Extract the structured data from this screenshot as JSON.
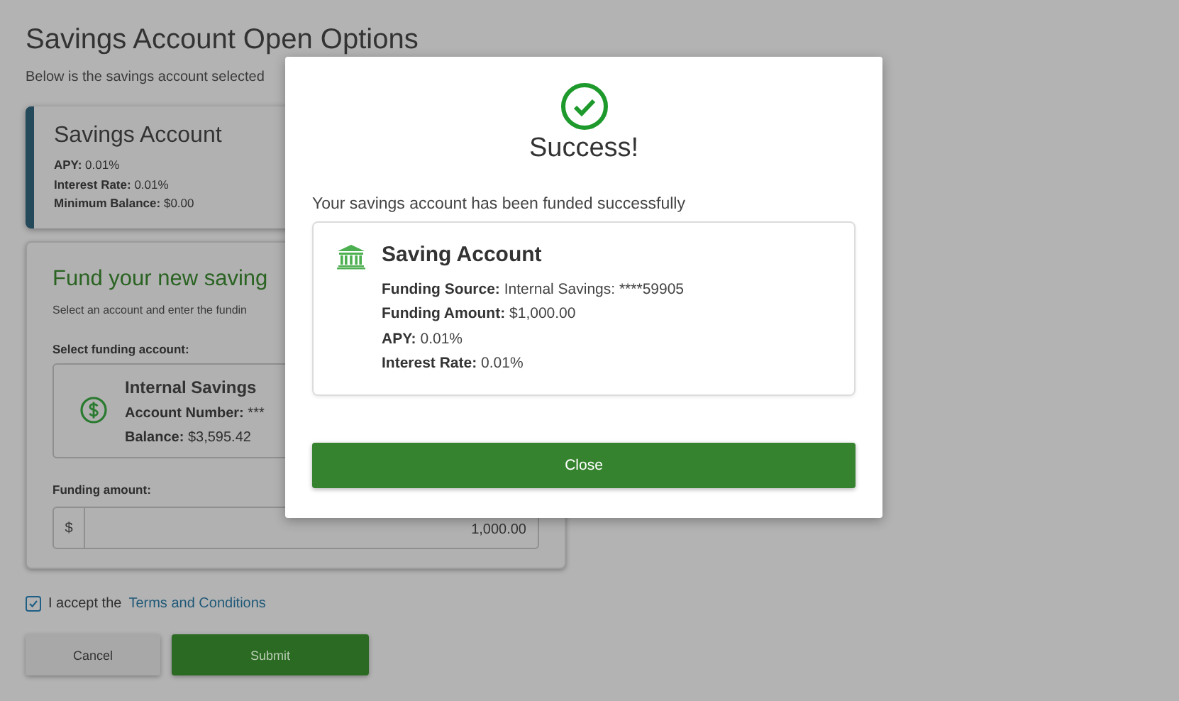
{
  "page": {
    "title": "Savings Account Open Options",
    "intro": "Below is the savings account selected"
  },
  "account_card": {
    "title": "Savings Account",
    "details": [
      {
        "label": "APY:",
        "value": "0.01%"
      },
      {
        "label": "Interest Rate:",
        "value": "0.01%"
      },
      {
        "label": "Minimum Balance:",
        "value": "$0.00"
      }
    ]
  },
  "funding_card": {
    "title": "Fund your new saving",
    "instructions": "Select an account and enter the fundin",
    "account_label": "Select funding account:",
    "account": {
      "name": "Internal Savings",
      "details": [
        {
          "label": "Account Number:",
          "value": "***"
        },
        {
          "label": "Balance:",
          "value": "$3,595.42"
        }
      ]
    },
    "amount_label": "Funding amount:",
    "amount": {
      "prefix": "$",
      "value": "1,000.00"
    }
  },
  "terms": {
    "checked": true,
    "text": "I accept the",
    "link": "Terms and Conditions"
  },
  "buttons": [
    {
      "label": "Cancel",
      "kind": "secondary"
    },
    {
      "label": "Submit",
      "kind": "primary"
    }
  ],
  "modal": {
    "title": "Success!",
    "message": "Your savings account has been funded successfully",
    "summary": {
      "title": "Saving Account",
      "details": [
        {
          "label": "Funding Source:",
          "value": "Internal Savings: ****59905"
        },
        {
          "label": "Funding Amount:",
          "value": "$1,000.00"
        },
        {
          "label": "APY:",
          "value": "0.01%"
        },
        {
          "label": "Interest Rate:",
          "value": "0.01%"
        }
      ]
    },
    "button": "Close"
  }
}
